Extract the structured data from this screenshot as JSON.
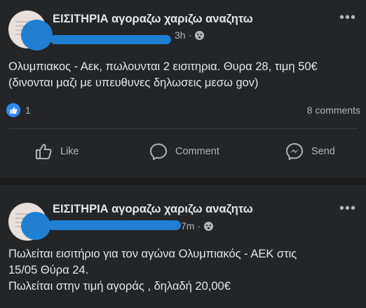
{
  "posts": [
    {
      "group": "ΕΙΣΙΤΗΡΙΑ αγοραζω χαριζω αναζητω",
      "time": "3h",
      "more_label": "•••",
      "text_lines": [
        "Ολυμπιακος - Αεκ, πωλουνται 2 εισιτηρια. Θυρα 28, τιμη 50€",
        "(δινονται μαζι με υπευθυνες δηλωσεις μεσω gov)"
      ],
      "reactions": "1",
      "comments": "8 comments"
    },
    {
      "group": "ΕΙΣΙΤΗΡΙΑ αγοραζω χαριζω αναζητω",
      "time": "7m",
      "more_label": "•••",
      "text_lines": [
        "Πωλείται εισιτήριο για τον αγώνα Ολυμπιακός - ΑΕΚ στις",
        "15/05 Θύρα 24.",
        "Πωλείται στην τιμή αγοράς , δηλαδή 20,00€"
      ]
    }
  ],
  "actions": {
    "like": "Like",
    "comment": "Comment",
    "send": "Send"
  },
  "icons": [
    "globe-icon",
    "more-icon",
    "like-reaction-icon",
    "like-icon",
    "comment-icon",
    "messenger-icon"
  ],
  "colors": {
    "background": "#1c1c1c",
    "card": "#242526",
    "text": "#e4e6eb",
    "secondary_text": "#b0b3b8",
    "like_blue": "#2d88ff",
    "redaction": "#1f7fd3"
  }
}
